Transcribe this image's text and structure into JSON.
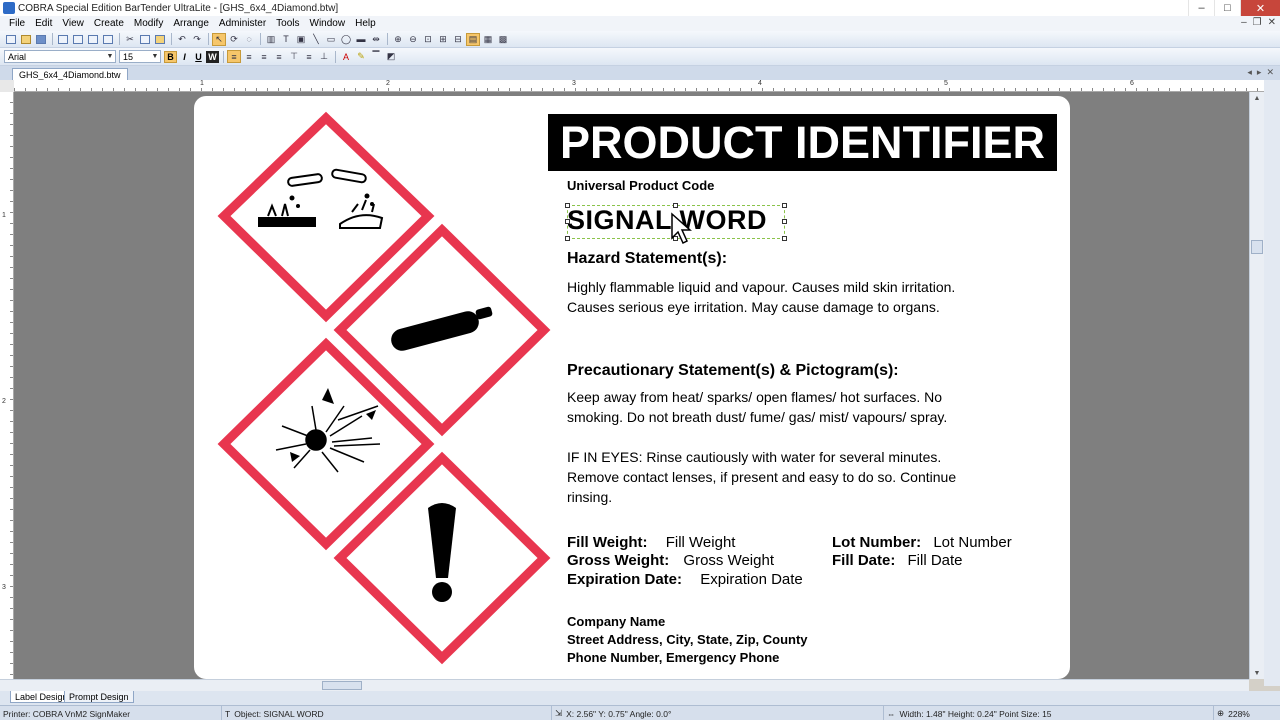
{
  "window": {
    "title": "COBRA Special Edition BarTender UltraLite - [GHS_6x4_4Diamond.btw]"
  },
  "menu": [
    "File",
    "Edit",
    "View",
    "Create",
    "Modify",
    "Arrange",
    "Administer",
    "Tools",
    "Window",
    "Help"
  ],
  "format_toolbar": {
    "font": "Arial",
    "size": "15",
    "bold": "B",
    "italic": "I",
    "underline": "U",
    "wordart": "W"
  },
  "document_tab": "GHS_6x4_4Diamond.btw",
  "ruler": {
    "h": [
      "1",
      "2",
      "3",
      "4",
      "5",
      "6"
    ],
    "v": [
      "1",
      "2",
      "3"
    ]
  },
  "label": {
    "product_identifier": "PRODUCT IDENTIFIER",
    "upc": "Universal Product Code",
    "signal_word": "SIGNAL WORD",
    "hazard_heading": "Hazard Statement(s):",
    "hazard_lines": [
      "Highly flammable liquid and vapour.  Causes mild skin irritation.",
      "Causes serious eye irritation.  May cause damage to organs."
    ],
    "precaution_heading": "Precautionary Statement(s) & Pictogram(s):",
    "precaution_lines": [
      "Keep away from heat/ sparks/ open flames/ hot surfaces. No",
      "smoking. Do not breath dust/ fume/ gas/ mist/ vapours/ spray."
    ],
    "eyes_lines": [
      "IF IN EYES: Rinse cautiously with water for several minutes.",
      "Remove contact lenses, if present and easy to do so. Continue",
      "rinsing."
    ],
    "fields": {
      "fill_weight_label": "Fill Weight:",
      "fill_weight_value": "Fill Weight",
      "gross_weight_label": "Gross Weight:",
      "gross_weight_value": "Gross Weight",
      "expiration_label": "Expiration Date:",
      "expiration_value": "Expiration Date",
      "lot_label": "Lot Number:",
      "lot_value": "Lot Number",
      "fill_date_label": "Fill Date:",
      "fill_date_value": "Fill Date"
    },
    "company_lines": [
      "Company Name",
      "Street Address, City, State, Zip, County",
      "Phone Number, Emergency Phone"
    ],
    "pictograms": [
      "corrosion-pictogram",
      "gas-cylinder-pictogram",
      "exploding-bomb-pictogram",
      "exclamation-mark-pictogram"
    ],
    "pictogram_color": "#e8364f"
  },
  "bottom_tabs": [
    "Label Design",
    "Prompt Design"
  ],
  "status": {
    "printer": "Printer: COBRA VnM2 SignMaker",
    "object": "Object: SIGNAL WORD",
    "position": "X: 2.56\"  Y: 0.75\"  Angle: 0.0°",
    "size": "Width: 1.48\"  Height: 0.24\"  Point Size: 15",
    "zoom": "228%"
  }
}
